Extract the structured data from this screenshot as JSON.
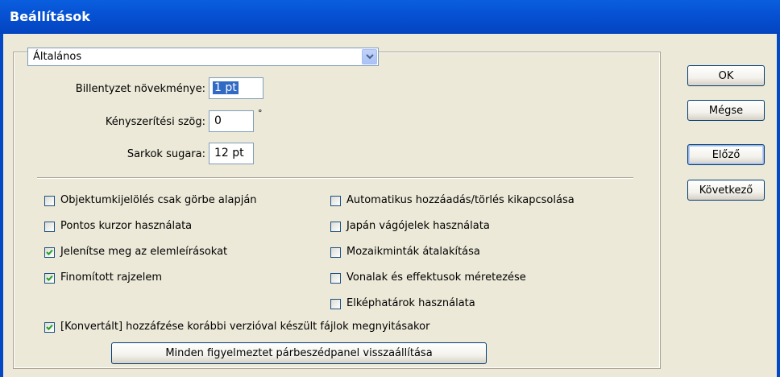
{
  "window": {
    "title": "Beállítások"
  },
  "section_dropdown": {
    "value": "Általános"
  },
  "fields": {
    "keyboard_increment": {
      "label": "Billentyzet növekménye:",
      "value": "1 pt"
    },
    "constrain_angle": {
      "label": "Kényszerítési szög:",
      "value": "0",
      "unit": "°"
    },
    "corner_radius": {
      "label": "Sarkok sugara:",
      "value": "12 pt"
    }
  },
  "options_left": [
    {
      "label": "Objektumkijelölés csak görbe alapján",
      "checked": false
    },
    {
      "label": "Pontos kurzor használata",
      "checked": false
    },
    {
      "label": "Jelenítse meg az elemleírásokat",
      "checked": true
    },
    {
      "label": "Finomított rajzelem",
      "checked": true
    }
  ],
  "options_right": [
    {
      "label": "Automatikus hozzáadás/törlés kikapcsolása",
      "checked": false
    },
    {
      "label": "Japán vágójelek használata",
      "checked": false
    },
    {
      "label": "Mozaikminták átalakítása",
      "checked": false
    },
    {
      "label": "Vonalak és effektusok méretezése",
      "checked": false
    },
    {
      "label": "Elképhatárok használata",
      "checked": false
    }
  ],
  "option_bottom": {
    "label": "[Konvertált] hozzáfzése korábbi verzióval készült fájlok megnyitásakor",
    "checked": true
  },
  "reset_button": {
    "label": "Minden figyelmeztet párbeszédpanel visszaállítása"
  },
  "buttons": {
    "ok": "OK",
    "cancel": "Mégse",
    "previous": "Előző",
    "next": "Következő"
  }
}
